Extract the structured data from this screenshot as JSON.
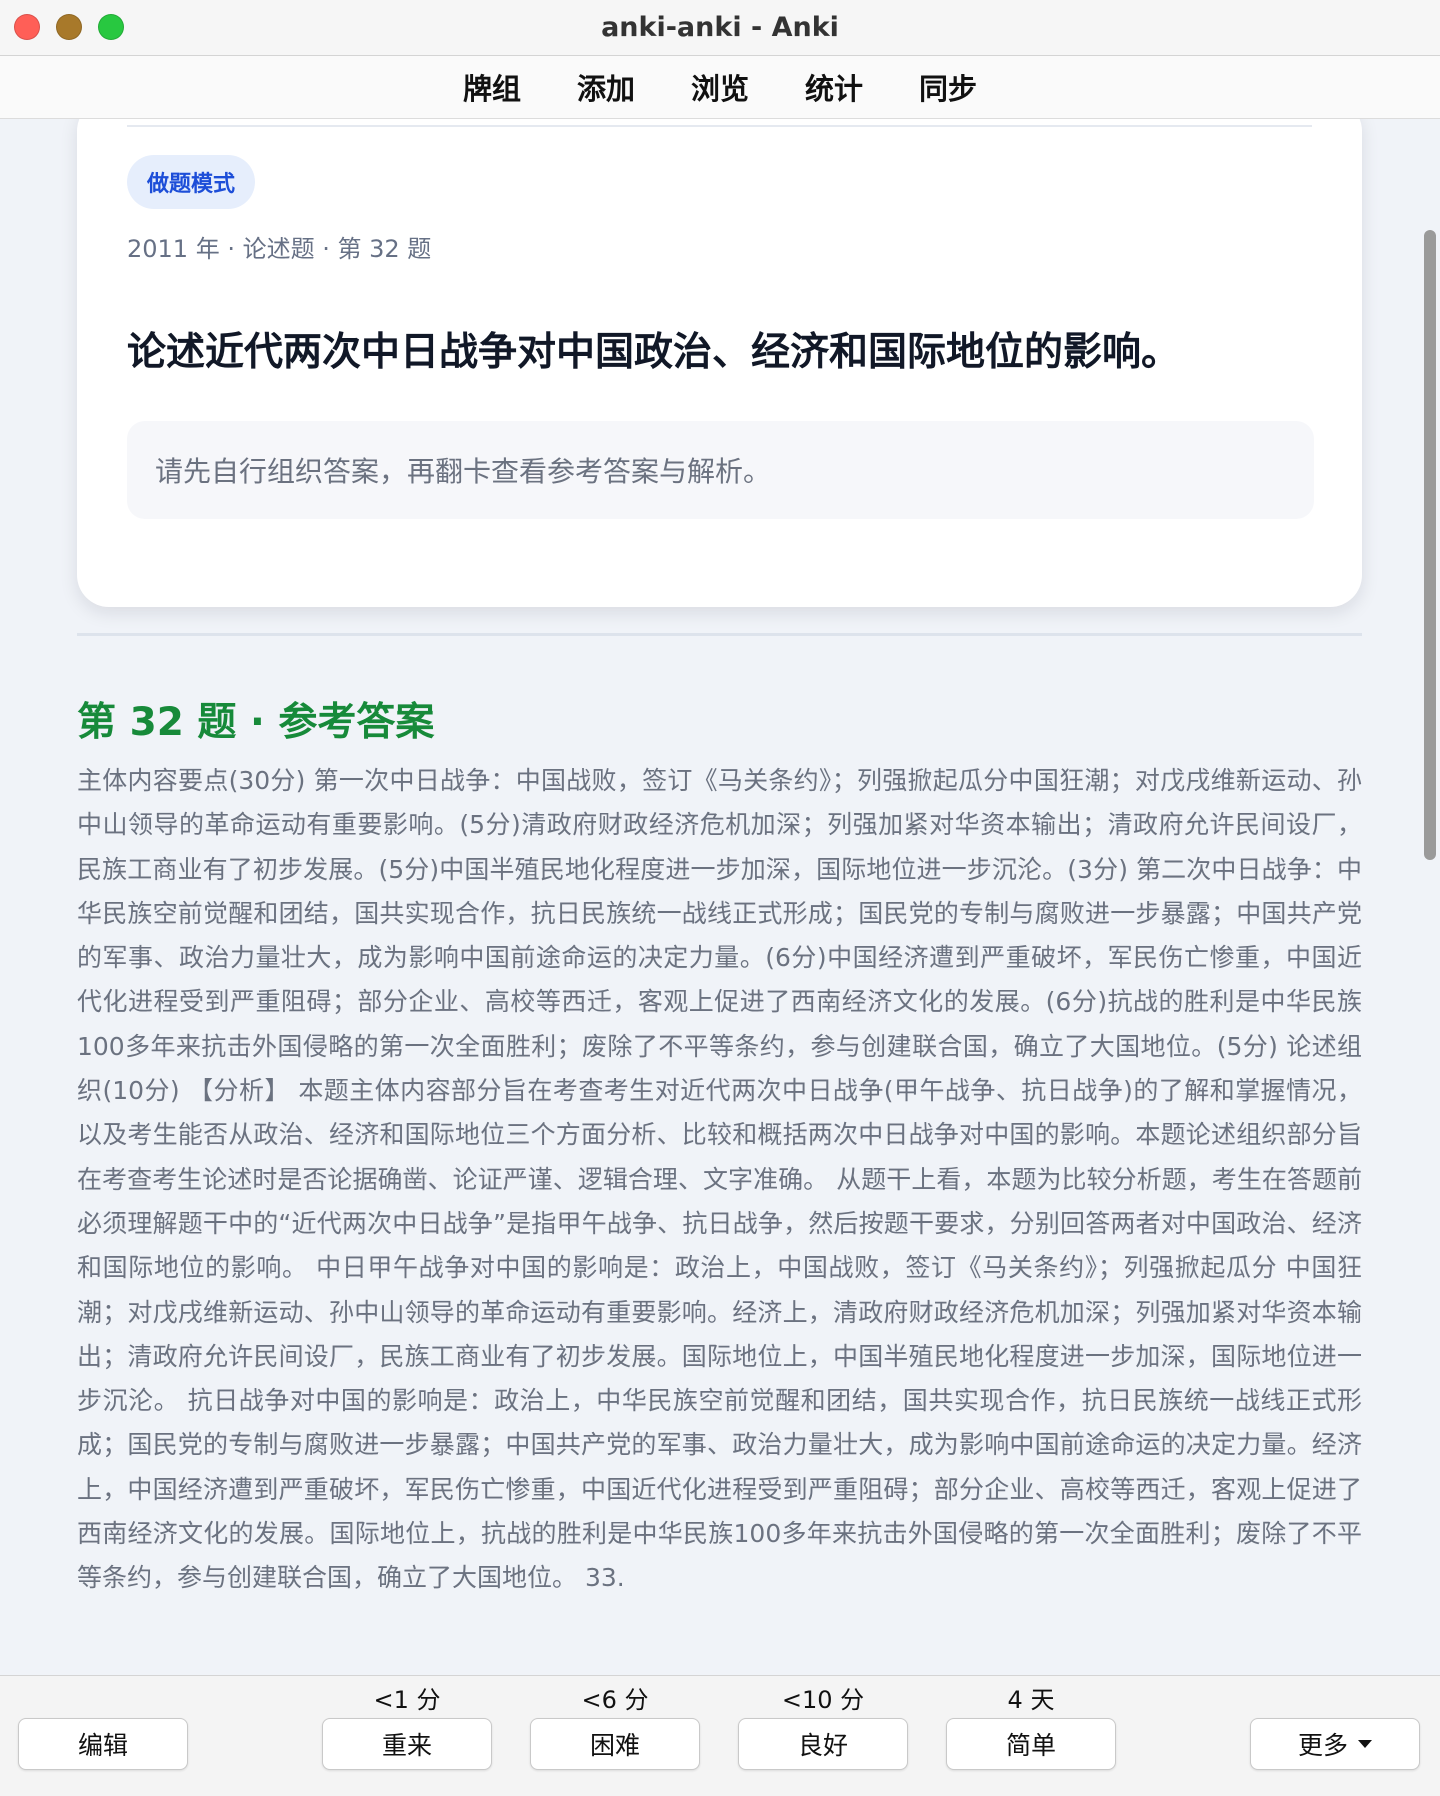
{
  "window": {
    "title": "anki-anki - Anki"
  },
  "nav": {
    "items": [
      "牌组",
      "添加",
      "浏览",
      "统计",
      "同步"
    ]
  },
  "card": {
    "mode_label": "做题模式",
    "meta": "2011 年 · 论述题 · 第 32 题",
    "question": "论述近代两次中日战争对中国政治、经济和国际地位的影响。",
    "hint": "请先自行组织答案，再翻卡查看参考答案与解析。"
  },
  "answer": {
    "title": "第 32 题 · 参考答案",
    "body": "主体内容要点(30分) 第一次中日战争：中国战败，签订《马关条约》；列强掀起瓜分中国狂潮；对戊戌维新运动、孙中山领导的革命运动有重要影响。(5分)清政府财政经济危机加深；列强加紧对华资本输出；清政府允许民间设厂，民族工商业有了初步发展。(5分)中国半殖民地化程度进一步加深，国际地位进一步沉沦。(3分) 第二次中日战争：中华民族空前觉醒和团结，国共实现合作，抗日民族统一战线正式形成；国民党的专制与腐败进一步暴露；中国共产党的军事、政治力量壮大，成为影响中国前途命运的决定力量。(6分)中国经济遭到严重破坏，军民伤亡惨重，中国近代化进程受到严重阻碍；部分企业、高校等西迁，客观上促进了西南经济文化的发展。(6分)抗战的胜利是中华民族100多年来抗击外国侵略的第一次全面胜利；废除了不平等条约，参与创建联合国，确立了大国地位。(5分) 论述组织(10分) 【分析】 本题主体内容部分旨在考查考生对近代两次中日战争(甲午战争、抗日战争)的了解和掌握情况，以及考生能否从政治、经济和国际地位三个方面分析、比较和概括两次中日战争对中国的影响。本题论述组织部分旨在考查考生论述时是否论据确凿、论证严谨、逻辑合理、文字准确。 从题干上看，本题为比较分析题，考生在答题前必须理解题干中的“近代两次中日战争”是指甲午战争、抗日战争，然后按题干要求，分别回答两者对中国政治、经济和国际地位的影响。 中日甲午战争对中国的影响是：政治上，中国战败，签订《马关条约》；列强掀起瓜分 中国狂潮；对戊戌维新运动、孙中山领导的革命运动有重要影响。经济上，清政府财政经济危机加深；列强加紧对华资本输出；清政府允许民间设厂，民族工商业有了初步发展。国际地位上，中国半殖民地化程度进一步加深，国际地位进一步沉沦。 抗日战争对中国的影响是：政治上，中华民族空前觉醒和团结，国共实现合作，抗日民族统一战线正式形成；国民党的专制与腐败进一步暴露；中国共产党的军事、政治力量壮大，成为影响中国前途命运的决定力量。经济上，中国经济遭到严重破坏，军民伤亡惨重，中国近代化进程受到严重阻碍；部分企业、高校等西迁，客观上促进了西南经济文化的发展。国际地位上，抗战的胜利是中华民族100多年来抗击外国侵略的第一次全面胜利；废除了不平等条约，参与创建联合国，确立了大国地位。 33."
  },
  "toolbar": {
    "edit": "编辑",
    "more": "更多",
    "answers": [
      {
        "label": "重来",
        "interval": "<1 分"
      },
      {
        "label": "困难",
        "interval": "<6 分"
      },
      {
        "label": "良好",
        "interval": "<10 分"
      },
      {
        "label": "简单",
        "interval": "4 天"
      }
    ]
  },
  "colors": {
    "accent_blue": "#1d4ed8",
    "answer_green": "#178a3a",
    "background": "#f0f3f8"
  }
}
